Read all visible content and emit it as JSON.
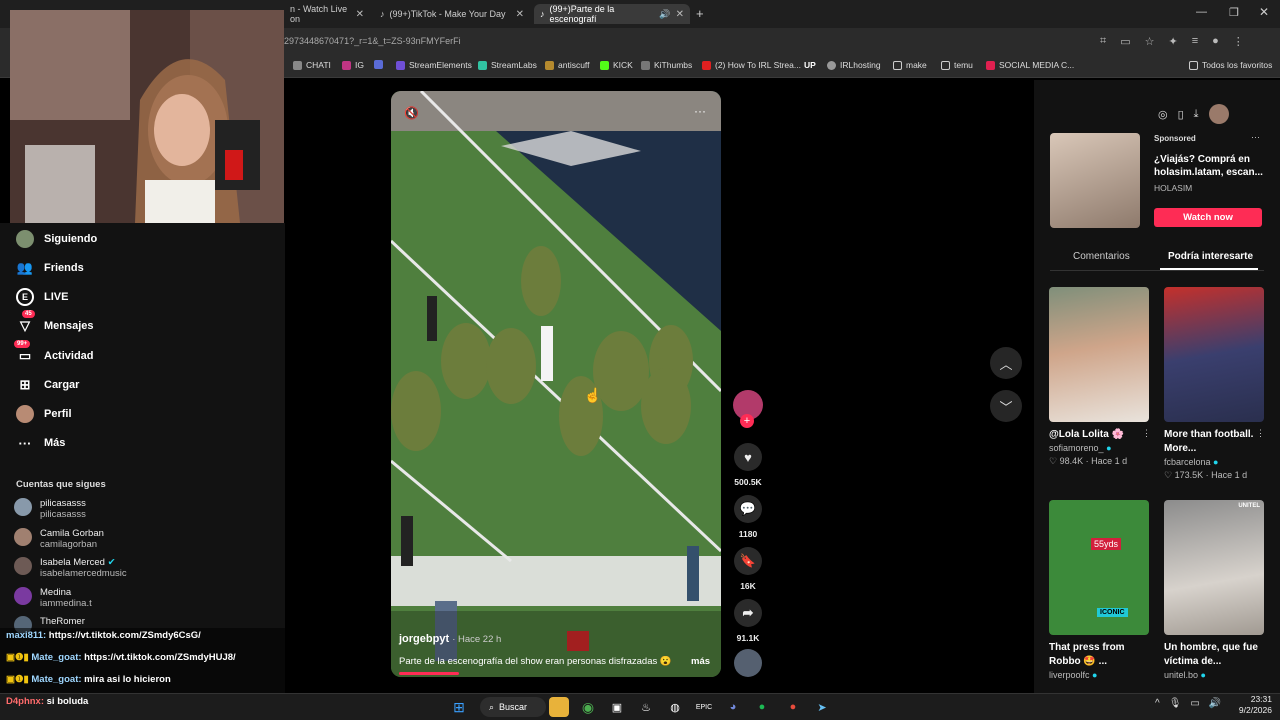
{
  "browser": {
    "tabs": [
      {
        "label": "n - Watch Live on"
      },
      {
        "label": "(99+)TikTok - Make Your Day"
      },
      {
        "label": "(99+)Parte de la escenografí"
      }
    ],
    "url": "2973448670471?_r=1&_t=ZS-93nFMYFerFi",
    "bookmarks": [
      "CHATI",
      "IG",
      "StreamElements",
      "StreamLabs",
      "antiscuff",
      "KICK",
      "KiThumbs",
      "(2) How To IRL Strea...",
      "IRLhosting",
      "make",
      "temu",
      "SOCIAL MEDIA C..."
    ],
    "all_bookmarks": "Todos los favoritos"
  },
  "sidebar": {
    "nav": [
      {
        "label": "Siguiendo"
      },
      {
        "label": "Friends"
      },
      {
        "label": "LIVE"
      },
      {
        "label": "Mensajes",
        "badge": "45"
      },
      {
        "label": "Actividad",
        "badge": "99+"
      },
      {
        "label": "Cargar"
      },
      {
        "label": "Perfil"
      },
      {
        "label": "Más"
      }
    ],
    "following_title": "Cuentas que sigues",
    "accounts": [
      {
        "name": "pilicasasss",
        "handle": "pilicasasss"
      },
      {
        "name": "Camila Gorban",
        "handle": "camilagorban"
      },
      {
        "name": "Isabela Merced",
        "handle": "isabelamercedmusic"
      },
      {
        "name": "Medina",
        "handle": "iammedina.t"
      },
      {
        "name": "TheRomer",
        "handle": ""
      }
    ]
  },
  "chat": [
    {
      "user": "maxi811:",
      "text": "https://vt.tiktok.com/ZSmdy6CsG/"
    },
    {
      "user": "Mate_goat:",
      "text": "https://vt.tiktok.com/ZSmdyHUJ8/"
    },
    {
      "user": "Mate_goat:",
      "text": "mira asi lo hicieron"
    },
    {
      "user": "D4phnx:",
      "text": "si boluda"
    }
  ],
  "video": {
    "author": "jorgebpyt",
    "time": "· Hace 22 h",
    "caption": "Parte de la escenografía del show eran personas disfrazadas 😮",
    "more": "más"
  },
  "actions": {
    "likes": "500.5K",
    "comments": "1180",
    "saves": "16K",
    "shares": "91.1K"
  },
  "ad": {
    "sponsored": "Sponsored",
    "title": "¿Viajás? Comprá en holasim.latam, escan...",
    "brand": "HOLASIM",
    "cta": "Watch now"
  },
  "right_tabs": [
    "Comentarios",
    "Podría interesarte"
  ],
  "recommended": [
    {
      "title": "@Lola Lolita 🌸",
      "author": "sofiamoreno_",
      "likes": "♡ 98.4K",
      "time": "· Hace 1 d"
    },
    {
      "title": "More than football. More...",
      "author": "fcbarcelona",
      "likes": "♡ 173.5K",
      "time": "· Hace 1 d"
    },
    {
      "title": "That press from Robbo 🤩 ...",
      "author": "liverpoolfc",
      "likes": "",
      "time": "",
      "overlay": "55yds",
      "badge": "ICONIC"
    },
    {
      "title": "Un hombre, que fue víctima de...",
      "author": "unitel.bo",
      "likes": "",
      "time": "",
      "overlay": "UNITEL"
    }
  ],
  "taskbar": {
    "search": "Buscar",
    "time": "23:31",
    "date": "9/2/2026"
  },
  "colors": {
    "accent": "#fe2c55",
    "bg": "#121212"
  }
}
